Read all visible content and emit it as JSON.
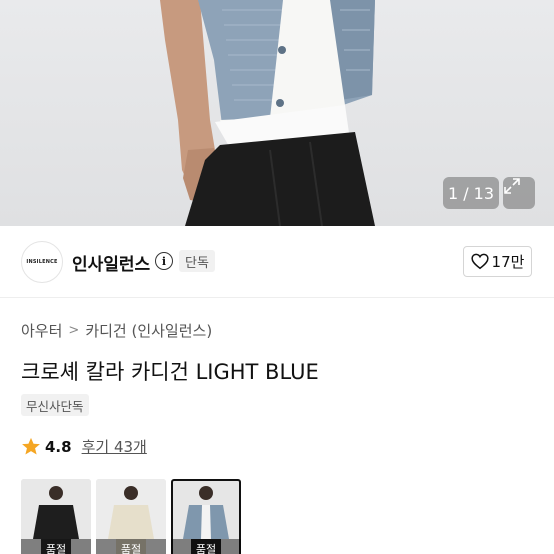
{
  "gallery": {
    "counter": "1 / 13"
  },
  "brand": {
    "logo_text": "INSILENCE",
    "name": "인사일런스",
    "exclusive_tag": "단독",
    "likes": "17만"
  },
  "breadcrumb": {
    "items": [
      "아우터",
      "카디건 (인사일런스)"
    ]
  },
  "product": {
    "title": "크로셰 칼라 카디건 LIGHT BLUE",
    "store_tag": "무신사단독",
    "rating": "4.8",
    "reviews": "후기 43개"
  },
  "variants": [
    {
      "label": "품절",
      "color": "#1e1e1e"
    },
    {
      "label": "품절",
      "color": "#e6dfcb"
    },
    {
      "label": "품절",
      "color": "#7f97ad"
    }
  ],
  "colors": {
    "star": "#f5a623",
    "cardigan": "#8ea3b8"
  }
}
